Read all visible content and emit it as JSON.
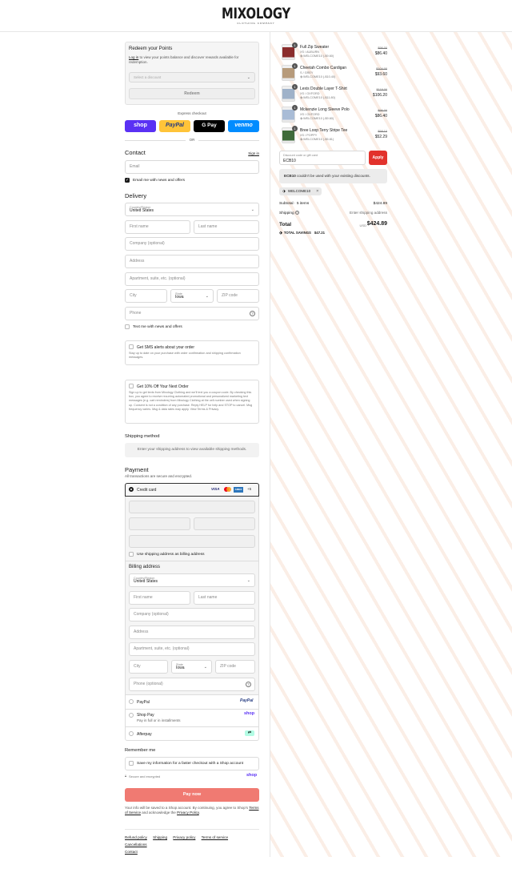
{
  "header": {
    "logo": "MIXOLOGY",
    "logo_sub": "CLOTHING COMPANY"
  },
  "points": {
    "title": "Redeem your Points",
    "login_link": "Log in",
    "desc": " to view your points balance and discover rewards available for redemption.",
    "select_placeholder": "Select a discount",
    "redeem_label": "Redeem"
  },
  "express": {
    "label": "Express checkout",
    "or": "OR",
    "shop": "shop",
    "paypal": "PayPal",
    "gpay": "G Pay",
    "venmo": "venmo"
  },
  "contact": {
    "title": "Contact",
    "sign_in": "Sign in",
    "email_placeholder": "Email",
    "news_label": "Email me with news and offers"
  },
  "delivery": {
    "title": "Delivery",
    "country_label": "Country/Region",
    "country_value": "United States",
    "first_name": "First name",
    "last_name": "Last name",
    "company": "Company (optional)",
    "address": "Address",
    "apartment": "Apartment, suite, etc. (optional)",
    "city": "City",
    "state_label": "State",
    "state_value": "Iowa",
    "zip": "ZIP code",
    "phone": "Phone",
    "text_offers": "Text me with news and offers"
  },
  "sms": {
    "title": "Get SMS alerts about your order",
    "desc": "Stay up to date on your purchase with order confirmation and shipping confirmation messages."
  },
  "promo": {
    "title": "Get 10% Off Your Next Order",
    "desc": "Sign up to get texts from Mixology Clothing and we'll text you a coupon code. By checking this box, you agree to receive recurring automated promotional and personalized marketing text messages (e.g. cart reminders) from Mixology Clothing at the cell number used when signing up. Consent is not a condition of any purchase. Reply HELP for help and STOP to cancel. Msg frequency varies. Msg & data rates may apply. View Terms & Privacy."
  },
  "shipping": {
    "title": "Shipping method",
    "message": "Enter your shipping address to view available shipping methods."
  },
  "payment": {
    "title": "Payment",
    "subtitle": "All transactions are secure and encrypted.",
    "credit_card": "Credit card",
    "more_cards": "+5",
    "use_shipping": "Use shipping address as billing address",
    "billing_title": "Billing address",
    "phone_optional": "Phone (optional)",
    "paypal": "PayPal",
    "paypal_logo": "PayPal",
    "shop_pay": "Shop Pay",
    "shop_pay_sub": "Pay in full or in installments",
    "shop_logo": "shop",
    "afterpay": "Afterpay"
  },
  "remember": {
    "title": "Remember me",
    "save_label": "Save my information for a faster checkout with a Shop account",
    "secure": "Secure and encrypted",
    "shop_logo": "shop"
  },
  "pay_now": "Pay now",
  "legal": {
    "text1": "Your info will be saved to a Shop account. By continuing, you agree to Shop's ",
    "terms": "Terms of Service",
    "text2": " and acknowledge the ",
    "privacy": "Privacy Policy",
    "text3": "."
  },
  "footer": [
    "Refund policy",
    "Shipping",
    "Privacy policy",
    "Terms of service",
    "Cancellations",
    "Contact"
  ],
  "cart": {
    "items": [
      {
        "name": "Full Zip Sweater",
        "variant": "XS / AUBURN",
        "discount": "WELCOME10 (-$9.60)",
        "old_price": "$96.00",
        "price": "$86.40",
        "qty": "1",
        "color": "#8a2d2d"
      },
      {
        "name": "Cheetah Combo Cardigan",
        "variant": "S / GREY",
        "discount": "WELCOME10 (-$10.40)",
        "old_price": "$104.00",
        "price": "$93.60",
        "qty": "1",
        "color": "#b79b7b"
      },
      {
        "name": "Lexis Double Layer T-Shirt",
        "variant": "XS / OXFORD",
        "discount": "WELCOME10 (-$11.80)",
        "old_price": "$118.00",
        "price": "$106.20",
        "qty": "1",
        "color": "#9fb2c9"
      },
      {
        "name": "Mckenzie Long Sleeve Polo",
        "variant": "XS / OXFORD",
        "discount": "WELCOME10 (-$9.60)",
        "old_price": "$96.00",
        "price": "$86.40",
        "qty": "1",
        "color": "#a9bcd6"
      },
      {
        "name": "Bree Loop Terry Stripe Tee",
        "variant": "XS / POPPY",
        "discount": "WELCOME10 (-$5.81)",
        "old_price": "$58.10",
        "price": "$52.29",
        "qty": "1",
        "color": "#3f6b3a"
      }
    ],
    "discount_label": "Discount code or gift card",
    "discount_value": "ECB10",
    "apply": "Apply",
    "error_code": "ECB10",
    "error_text": " couldn't be used with your existing discounts.",
    "tag": "WELCOME10",
    "subtotal_label": "Subtotal · 5 items",
    "subtotal": "$424.89",
    "shipping_label": "Shipping",
    "shipping_value": "Enter shipping address",
    "total_label": "Total",
    "currency": "USD",
    "total": "$424.89",
    "savings_label": "TOTAL SAVINGS",
    "savings": "$47.21"
  },
  "colors": {
    "pay_button": "#f07a72",
    "apply_button": "#e2322c",
    "shop_purple": "#5a31f4",
    "paypal_yellow": "#ffc439",
    "venmo_blue": "#008cff"
  }
}
